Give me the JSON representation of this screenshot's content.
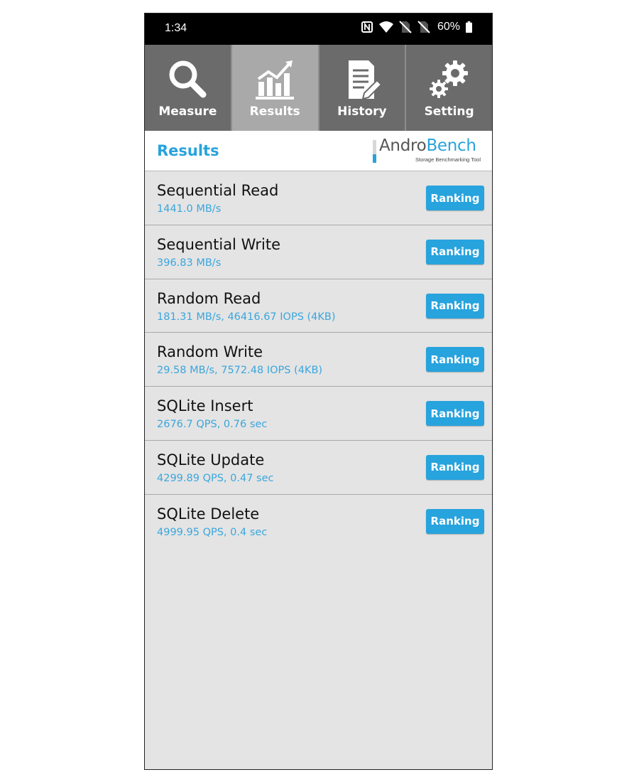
{
  "status_bar": {
    "time": "1:34",
    "battery": "60%",
    "icons": [
      "nfc-icon",
      "wifi-icon",
      "no-sim-icon",
      "no-sim-icon",
      "battery-icon"
    ]
  },
  "tabs": [
    {
      "label": "Measure",
      "icon": "magnifier-icon",
      "active": false
    },
    {
      "label": "Results",
      "icon": "bar-chart-icon",
      "active": true
    },
    {
      "label": "History",
      "icon": "document-pencil-icon",
      "active": false
    },
    {
      "label": "Setting",
      "icon": "gears-icon",
      "active": false
    }
  ],
  "header": {
    "title": "Results",
    "logo_andro": "Andro",
    "logo_bench": "Bench",
    "logo_subtitle": "Storage Benchmarking Tool"
  },
  "results": [
    {
      "name": "Sequential Read",
      "value": "1441.0 MB/s",
      "button": "Ranking"
    },
    {
      "name": "Sequential Write",
      "value": "396.83 MB/s",
      "button": "Ranking"
    },
    {
      "name": "Random Read",
      "value": "181.31 MB/s, 46416.67 IOPS (4KB)",
      "button": "Ranking"
    },
    {
      "name": "Random Write",
      "value": "29.58 MB/s, 7572.48 IOPS (4KB)",
      "button": "Ranking"
    },
    {
      "name": "SQLite Insert",
      "value": "2676.7 QPS, 0.76 sec",
      "button": "Ranking"
    },
    {
      "name": "SQLite Update",
      "value": "4299.89 QPS, 0.47 sec",
      "button": "Ranking"
    },
    {
      "name": "SQLite Delete",
      "value": "4999.95 QPS, 0.4 sec",
      "button": "Ranking"
    }
  ],
  "colors": {
    "accent": "#27a3dd",
    "tab_bg": "#6b6b6b",
    "tab_active_bg": "#a9a9a9",
    "list_bg": "#e4e4e4",
    "status_bar_bg": "#000000"
  }
}
